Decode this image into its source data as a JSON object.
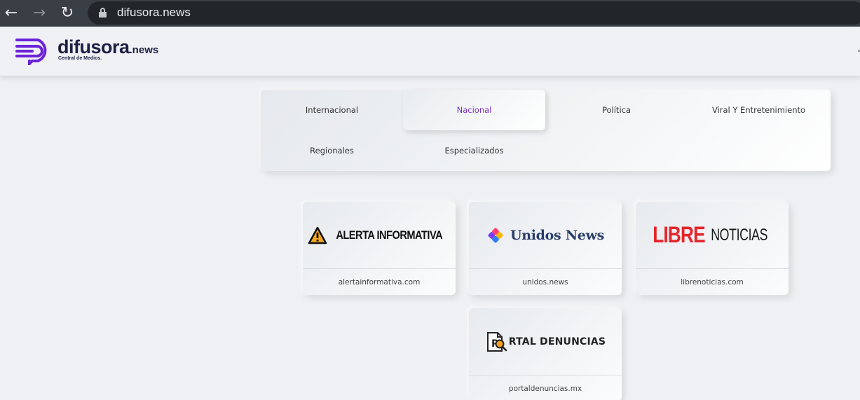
{
  "browser": {
    "url": "difusora.news"
  },
  "site": {
    "logo_name": "difusora",
    "logo_tld": ".news",
    "logo_tagline": "Central de Medios.",
    "brand_color": "#6c22d9"
  },
  "categories": [
    {
      "label": "Internacional",
      "active": false
    },
    {
      "label": "Nacional",
      "active": true
    },
    {
      "label": "Política",
      "active": false
    },
    {
      "label": "Viral Y Entretenimiento",
      "active": false
    },
    {
      "label": "Regionales",
      "active": false
    },
    {
      "label": "Especializados",
      "active": false
    }
  ],
  "active_color": "#7b2fbe",
  "cards": [
    {
      "logo_text": "ALERTA INFORMATIVA",
      "domain": "alertainformativa.com"
    },
    {
      "logo_text": "Unidos News",
      "domain": "unidos.news"
    },
    {
      "logo_text_a": "LIBRE",
      "logo_text_b": "NOTICIAS",
      "domain": "librenoticias.com"
    },
    {
      "logo_text": "RTAL DENUNCIAS",
      "domain": "portaldenuncias.mx"
    }
  ]
}
